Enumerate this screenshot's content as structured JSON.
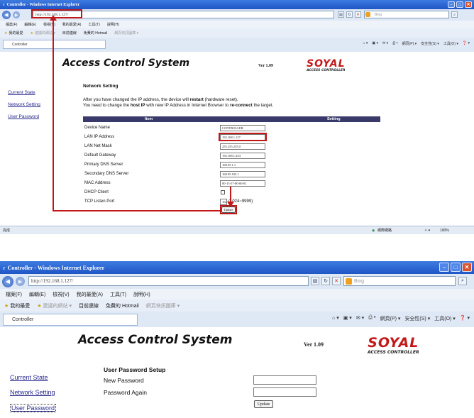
{
  "window": {
    "title": "Controller - Windows Internet Explorer",
    "url": "http://192.168.1.127/",
    "search_placeholder": "Bing",
    "menu": [
      "檔案(F)",
      "編輯(E)",
      "檢視(V)",
      "我的最愛(A)",
      "工具(T)",
      "說明(H)"
    ],
    "favorites": [
      "我的最愛",
      "建議的網站 ▾",
      "目前連線",
      "免費的 Hotmail",
      "網頁快訊圖庫 ▾"
    ],
    "tab": "Controller",
    "commands": [
      "網頁(P) ▾",
      "安全性(S) ▾",
      "工具(O) ▾"
    ],
    "status_left": "完成",
    "status_zone": "網際網路",
    "zoom": "100%"
  },
  "app": {
    "title": "Access Control System",
    "version": "Ver 1.09",
    "logo_brand": "SOYAL",
    "logo_sub": "ACCESS CONTROLLER"
  },
  "nav": {
    "current_state": "Current State",
    "network_setting": "Network Setting",
    "user_password": "User Password"
  },
  "network": {
    "title": "Network Setting",
    "note1_pre": "After you have changed the IP address, the device will ",
    "note1_bold": "restart",
    "note1_post": " (hardware reset).",
    "note2_pre": "You need to change the ",
    "note2_bold": "host IP",
    "note2_mid": " with new IP Address in Internet Browser to ",
    "note2_bold2": "re-connect",
    "note2_post": " the target.",
    "col_item": "Item",
    "col_setting": "Setting",
    "rows": [
      {
        "label": "Device Name",
        "value": "CONTROLLER"
      },
      {
        "label": "LAN IP Address",
        "value": "192.168.1.127"
      },
      {
        "label": "LAN Net Mask",
        "value": "255.255.255.0"
      },
      {
        "label": "Default Gateway",
        "value": "192.168.1.254"
      },
      {
        "label": "Primary DNS Server",
        "value": "168.95.1.1"
      },
      {
        "label": "Secondary DNS Server",
        "value": "168.95.192.1"
      },
      {
        "label": "MAC Address",
        "value": "00-13-57-00-00-01"
      },
      {
        "label": "DHCP Client",
        "value": ""
      },
      {
        "label": "TCP Listen Port",
        "value": "1621"
      }
    ],
    "port_hint": "(1024~9999)",
    "update": "Update"
  },
  "password": {
    "title": "User Password Setup",
    "new_label": "New Password",
    "again_label": "Password Again",
    "update": "Update"
  },
  "colors": {
    "highlight": "#c01818",
    "title_bar": "#2a62d0",
    "nav_link": "#2a2a8e",
    "table_header": "#3a3a6a"
  }
}
